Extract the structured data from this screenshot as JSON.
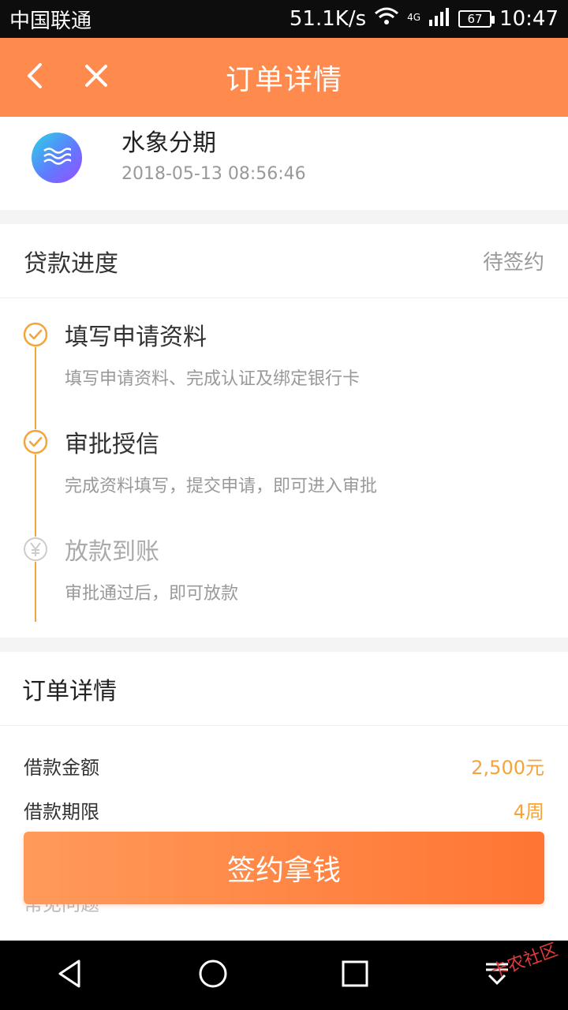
{
  "status_bar": {
    "carrier": "中国联通",
    "speed": "51.1K/s",
    "network": "4G",
    "battery": "67",
    "time": "10:47"
  },
  "header": {
    "title": "订单详情",
    "back_icon": "chevron-left-icon",
    "close_icon": "close-icon"
  },
  "company": {
    "name": "水象分期",
    "date": "2018-05-13 08:56:46",
    "logo_icon": "water-wave-icon"
  },
  "progress": {
    "title": "贷款进度",
    "status": "待签约",
    "steps": [
      {
        "title": "填写申请资料",
        "desc": "填写申请资料、完成认证及绑定银行卡",
        "state": "done"
      },
      {
        "title": "审批授信",
        "desc": "完成资料填写，提交申请，即可进入审批",
        "state": "done"
      },
      {
        "title": "放款到账",
        "desc": "审批通过后，即可放款",
        "state": "pending"
      }
    ]
  },
  "order": {
    "title": "订单详情",
    "rows": [
      {
        "label": "借款金额",
        "value": "2,500元"
      },
      {
        "label": "借款期限",
        "value": "4周"
      }
    ],
    "faq": "常见问题"
  },
  "cta": {
    "label": "签约拿钱"
  },
  "nav": {
    "back": "triangle-back-icon",
    "home": "circle-home-icon",
    "recent": "square-recent-icon",
    "menu": "drawer-down-icon"
  },
  "watermark": "卡农社区",
  "colors": {
    "accent": "#ff8a4d",
    "progress": "#f5a33b",
    "text_muted": "#999999"
  }
}
